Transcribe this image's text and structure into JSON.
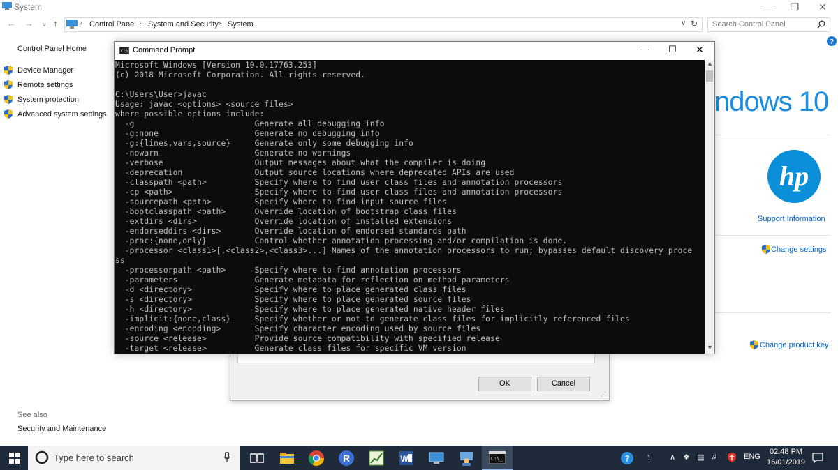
{
  "window": {
    "title": "System"
  },
  "address": {
    "crumbs": [
      "Control Panel",
      "System and Security",
      "System"
    ]
  },
  "search": {
    "placeholder": "Search Control Panel"
  },
  "sidebar": {
    "home": "Control Panel Home",
    "items": [
      {
        "label": "Device Manager"
      },
      {
        "label": "Remote settings"
      },
      {
        "label": "System protection"
      },
      {
        "label": "Advanced system settings"
      }
    ],
    "see_also": "See also",
    "security": "Security and Maintenance"
  },
  "right": {
    "logo_text": "ndows 10",
    "support": "Support Information",
    "change_settings": "Change settings",
    "change_key": "Change product key"
  },
  "cmd": {
    "title": "Command Prompt",
    "lines": [
      "Microsoft Windows [Version 10.0.17763.253]",
      "(c) 2018 Microsoft Corporation. All rights reserved.",
      "",
      "C:\\Users\\User>javac",
      "Usage: javac <options> <source files>",
      "where possible options include:",
      "  -g                         Generate all debugging info",
      "  -g:none                    Generate no debugging info",
      "  -g:{lines,vars,source}     Generate only some debugging info",
      "  -nowarn                    Generate no warnings",
      "  -verbose                   Output messages about what the compiler is doing",
      "  -deprecation               Output source locations where deprecated APIs are used",
      "  -classpath <path>          Specify where to find user class files and annotation processors",
      "  -cp <path>                 Specify where to find user class files and annotation processors",
      "  -sourcepath <path>         Specify where to find input source files",
      "  -bootclasspath <path>      Override location of bootstrap class files",
      "  -extdirs <dirs>            Override location of installed extensions",
      "  -endorseddirs <dirs>       Override location of endorsed standards path",
      "  -proc:{none,only}          Control whether annotation processing and/or compilation is done.",
      "  -processor <class1>[,<class2>,<class3>...] Names of the annotation processors to run; bypasses default discovery proce",
      "ss",
      "  -processorpath <path>      Specify where to find annotation processors",
      "  -parameters                Generate metadata for reflection on method parameters",
      "  -d <directory>             Specify where to place generated class files",
      "  -s <directory>             Specify where to place generated source files",
      "  -h <directory>             Specify where to place generated native header files",
      "  -implicit:{none,class}     Specify whether or not to generate class files for implicitly referenced files",
      "  -encoding <encoding>       Specify character encoding used by source files",
      "  -source <release>          Provide source compatibility with specified release",
      "  -target <release>          Generate class files for specific VM version"
    ]
  },
  "dialog": {
    "ok": "OK",
    "cancel": "Cancel"
  },
  "taskbar": {
    "search_placeholder": "Type here to search",
    "lang": "ENG",
    "time": "02:48 PM",
    "date": "16/01/2019"
  },
  "colors": {
    "accent": "#1b8ee0",
    "taskbar": "#1f2a3a",
    "console_bg": "#0c0c0c",
    "console_fg": "#c0c0c0"
  }
}
